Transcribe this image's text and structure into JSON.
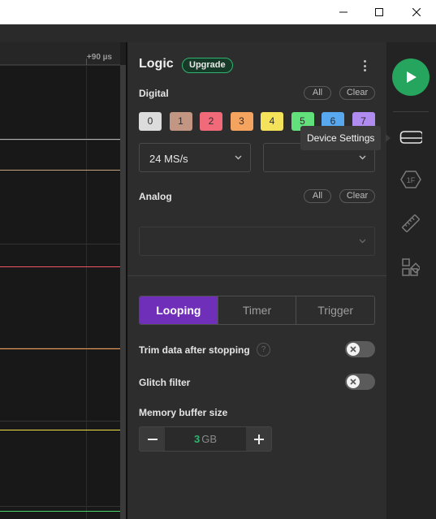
{
  "window": {
    "controls": {
      "minimize_icon": "minimize-icon",
      "maximize_icon": "maximize-icon",
      "close_icon": "close-icon"
    }
  },
  "waveform": {
    "time_offset_label": "+90 µs",
    "channel_colors": [
      "#b0b0b0",
      "#c9a27e",
      "#ef5563",
      "#f29b4c",
      "#f0e04a",
      "#49d467"
    ]
  },
  "panel": {
    "title": "Logic",
    "upgrade_label": "Upgrade",
    "more_icon": "kebab-menu-icon",
    "digital": {
      "label": "Digital",
      "all_label": "All",
      "clear_label": "Clear",
      "channels": [
        {
          "label": "0",
          "color": "#dcdcdc"
        },
        {
          "label": "1",
          "color": "#c39684"
        },
        {
          "label": "2",
          "color": "#f06a7a"
        },
        {
          "label": "3",
          "color": "#f5a45f"
        },
        {
          "label": "4",
          "color": "#f4e25a"
        },
        {
          "label": "5",
          "color": "#62e07b"
        },
        {
          "label": "6",
          "color": "#58a8f0"
        },
        {
          "label": "7",
          "color": "#b08cf0"
        }
      ],
      "sample_rate": "24 MS/s",
      "voltage": ""
    },
    "analog": {
      "label": "Analog",
      "all_label": "All",
      "clear_label": "Clear",
      "sample_rate": ""
    },
    "capture_mode": {
      "options": [
        "Looping",
        "Timer",
        "Trigger"
      ],
      "selected": "Looping"
    },
    "trim_label": "Trim data after stopping",
    "trim_help": "?",
    "trim_enabled": false,
    "glitch_label": "Glitch filter",
    "glitch_enabled": false,
    "memory": {
      "label": "Memory buffer size",
      "value": "3",
      "unit": "GB"
    }
  },
  "rail": {
    "play_icon": "play-icon",
    "device_settings_icon": "device-settings-icon",
    "analyzers_icon": "hex-analyzer-icon",
    "measure_icon": "ruler-icon",
    "extensions_icon": "extensions-icon",
    "tooltip": "Device Settings"
  },
  "colors": {
    "accent_purple": "#6f2fb8",
    "play_green": "#25a55d",
    "memory_value_green": "#2fb36e"
  }
}
